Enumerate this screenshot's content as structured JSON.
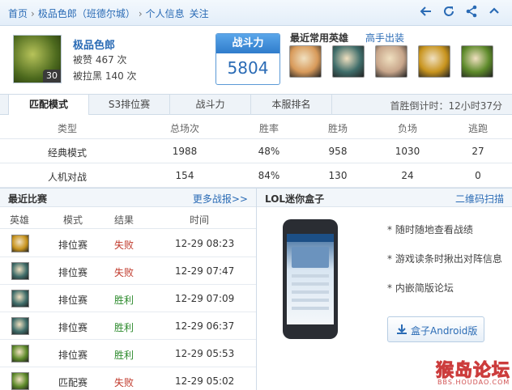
{
  "breadcrumb": {
    "home": "首页",
    "player": "极品色郎（班德尔城）",
    "page": "个人信息",
    "follow": "关注"
  },
  "toolbar": {
    "icons": [
      "back-arrow-icon",
      "refresh-icon",
      "share-icon",
      "collapse-icon"
    ]
  },
  "profile": {
    "name": "极品色郎",
    "level": "30",
    "liked": "被赞 467 次",
    "blacklisted": "被拉黑 140 次",
    "power_label": "战斗力",
    "power_value": "5804"
  },
  "favorite_heroes": {
    "title": "最近常用英雄",
    "link": "高手出装",
    "heroes": [
      {
        "icon": "hero-lux-icon",
        "color": "#d89a5a"
      },
      {
        "icon": "hero-fizz-icon",
        "color": "#3f6d6a"
      },
      {
        "icon": "hero-gragas-icon",
        "color": "#c7a58a"
      },
      {
        "icon": "hero-blitzcrank-icon",
        "color": "#c8941e"
      },
      {
        "icon": "hero-kogmaw-icon",
        "color": "#5d8a2a"
      }
    ]
  },
  "tabs": [
    "匹配模式",
    "S3排位赛",
    "战斗力",
    "本服排名"
  ],
  "countdown": "首胜倒计时：12小时37分",
  "stats": {
    "headers": [
      "类型",
      "总场次",
      "胜率",
      "胜场",
      "负场",
      "逃跑"
    ],
    "rows": [
      [
        "经典模式",
        "1988",
        "48%",
        "958",
        "1030",
        "27"
      ],
      [
        "人机对战",
        "154",
        "84%",
        "130",
        "24",
        "0"
      ]
    ]
  },
  "recent": {
    "title": "最近比赛",
    "more": "更多战报>>",
    "headers": [
      "英雄",
      "模式",
      "结果",
      "时间"
    ],
    "rows": [
      {
        "hero": "hero-blitzcrank-icon",
        "color": "#c8941e",
        "mode": "排位赛",
        "result": "失败",
        "win": false,
        "time": "12-29 08:23"
      },
      {
        "hero": "hero-fizz-icon",
        "color": "#3f6d6a",
        "mode": "排位赛",
        "result": "失败",
        "win": false,
        "time": "12-29 07:47"
      },
      {
        "hero": "hero-fizz-icon",
        "color": "#3f6d6a",
        "mode": "排位赛",
        "result": "胜利",
        "win": true,
        "time": "12-29 07:09"
      },
      {
        "hero": "hero-fizz-icon",
        "color": "#3f6d6a",
        "mode": "排位赛",
        "result": "胜利",
        "win": true,
        "time": "12-29 06:37"
      },
      {
        "hero": "hero-kogmaw-icon",
        "color": "#5d8a2a",
        "mode": "排位赛",
        "result": "胜利",
        "win": true,
        "time": "12-29 05:53"
      },
      {
        "hero": "hero-kogmaw-icon",
        "color": "#5d8a2a",
        "mode": "匹配赛",
        "result": "失败",
        "win": false,
        "time": "12-29 05:02"
      }
    ]
  },
  "promo": {
    "title": "LOL迷你盒子",
    "qr_link": "二维码扫描",
    "features": [
      "* 随时随地查看战绩",
      "* 游戏读条时揪出对阵信息",
      "* 内嵌简版论坛"
    ],
    "download": "盒子Android版"
  },
  "watermark": {
    "text": "猴岛论坛",
    "url": "BBS.HOUDAO.COM"
  }
}
